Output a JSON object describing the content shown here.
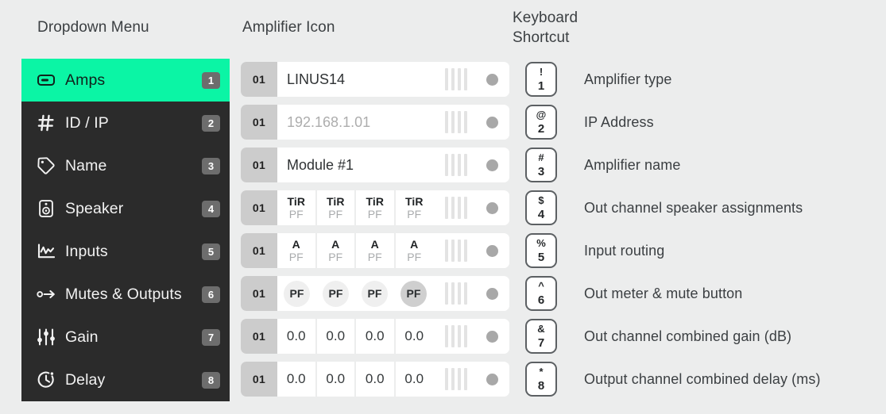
{
  "headers": {
    "dropdown_menu": "Dropdown Menu",
    "amplifier_icon": "Amplifier Icon",
    "keyboard_shortcut": "Keyboard Shortcut"
  },
  "colors": {
    "accent_green": "#0bf5a5",
    "sidebar_bg": "#2b2b2b",
    "page_bg": "#eceded",
    "badge_bg": "#6d6d6d",
    "id_chip_bg": "#cccccc",
    "led": "#a8a8a8"
  },
  "sidebar": {
    "items": [
      {
        "label": "Amps",
        "badge": "1",
        "icon": "amplifier-icon",
        "active": true
      },
      {
        "label": "ID / IP",
        "badge": "2",
        "icon": "hash-icon",
        "active": false
      },
      {
        "label": "Name",
        "badge": "3",
        "icon": "tag-icon",
        "active": false
      },
      {
        "label": "Speaker",
        "badge": "4",
        "icon": "speaker-icon",
        "active": false
      },
      {
        "label": "Inputs",
        "badge": "5",
        "icon": "waveform-chart-icon",
        "active": false
      },
      {
        "label": "Mutes & Outputs",
        "badge": "6",
        "icon": "signal-out-arrow-icon",
        "active": false
      },
      {
        "label": "Gain",
        "badge": "7",
        "icon": "sliders-icon",
        "active": false
      },
      {
        "label": "Delay",
        "badge": "8",
        "icon": "timer-icon",
        "active": false
      }
    ]
  },
  "rows": [
    {
      "id": "01",
      "kind": "text",
      "value": "LINUS14",
      "placeholder": false,
      "key": {
        "symbol": "!",
        "number": "1"
      },
      "description": "Amplifier type"
    },
    {
      "id": "01",
      "kind": "text",
      "value": "192.168.1.01",
      "placeholder": true,
      "key": {
        "symbol": "@",
        "number": "2"
      },
      "description": "IP Address"
    },
    {
      "id": "01",
      "kind": "text",
      "value": "Module #1",
      "placeholder": false,
      "key": {
        "symbol": "#",
        "number": "3"
      },
      "description": "Amplifier name"
    },
    {
      "id": "01",
      "kind": "stacked",
      "cells": [
        {
          "top": "TiR",
          "bottom": "PF"
        },
        {
          "top": "TiR",
          "bottom": "PF"
        },
        {
          "top": "TiR",
          "bottom": "PF"
        },
        {
          "top": "TiR",
          "bottom": "PF"
        }
      ],
      "key": {
        "symbol": "$",
        "number": "4"
      },
      "description": "Out channel speaker assignments"
    },
    {
      "id": "01",
      "kind": "stacked",
      "cells": [
        {
          "top": "A",
          "bottom": "PF"
        },
        {
          "top": "A",
          "bottom": "PF"
        },
        {
          "top": "A",
          "bottom": "PF"
        },
        {
          "top": "A",
          "bottom": "PF"
        }
      ],
      "key": {
        "symbol": "%",
        "number": "5"
      },
      "description": "Input routing"
    },
    {
      "id": "01",
      "kind": "pills",
      "cells": [
        {
          "label": "PF",
          "strong": false
        },
        {
          "label": "PF",
          "strong": false
        },
        {
          "label": "PF",
          "strong": false
        },
        {
          "label": "PF",
          "strong": true
        }
      ],
      "key": {
        "symbol": "^",
        "number": "6"
      },
      "description": "Out meter & mute button"
    },
    {
      "id": "01",
      "kind": "numeric",
      "cells": [
        {
          "value": "0.0"
        },
        {
          "value": "0.0"
        },
        {
          "value": "0.0"
        },
        {
          "value": "0.0"
        }
      ],
      "key": {
        "symbol": "&",
        "number": "7"
      },
      "description": "Out channel combined gain (dB)"
    },
    {
      "id": "01",
      "kind": "numeric",
      "cells": [
        {
          "value": "0.0"
        },
        {
          "value": "0.0"
        },
        {
          "value": "0.0"
        },
        {
          "value": "0.0"
        }
      ],
      "key": {
        "symbol": "*",
        "number": "8"
      },
      "description": "Output channel combined delay (ms)"
    }
  ]
}
